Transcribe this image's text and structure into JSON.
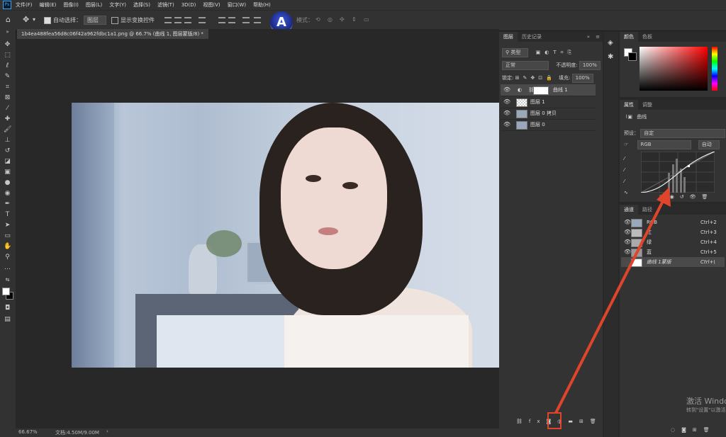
{
  "menubar": {
    "app_icon": "Ps",
    "items": [
      "文件(F)",
      "编辑(E)",
      "图像(I)",
      "图层(L)",
      "文字(Y)",
      "选择(S)",
      "滤镜(T)",
      "3D(D)",
      "视图(V)",
      "窗口(W)",
      "帮助(H)"
    ]
  },
  "options": {
    "auto_select_label": "自动选择：",
    "auto_select_value": "图层",
    "show_transform_label": "显示变换控件",
    "mode_3d_label": "模式："
  },
  "document": {
    "tab_title": "1b4ea488fea56d8c06f42a962fdbc1a1.png @ 66.7% (曲线 1, 图层蒙版/8) *"
  },
  "status": {
    "zoom": "66.67%",
    "doc_size": "文档:4.50M/9.00M"
  },
  "layers_panel": {
    "tabs": [
      "图层",
      "历史记录"
    ],
    "filter_label": "类型",
    "blend_mode": "正常",
    "opacity_label": "不透明度:",
    "opacity_value": "100%",
    "lock_label": "锁定:",
    "fill_label": "填充:",
    "fill_value": "100%",
    "layers": [
      {
        "name": "曲线 1",
        "selected": true
      },
      {
        "name": "图层 1",
        "selected": false
      },
      {
        "name": "图层 0 拷贝",
        "selected": false
      },
      {
        "name": "图层 0",
        "selected": false
      }
    ]
  },
  "color_panel": {
    "tabs": [
      "颜色",
      "色板"
    ]
  },
  "properties_panel": {
    "tabs": [
      "属性",
      "调整"
    ],
    "title": "曲线",
    "preset_label": "预设：",
    "preset_value": "自定",
    "channel_value": "RGB",
    "auto_label": "自动"
  },
  "channels_panel": {
    "tabs": [
      "通道",
      "路径"
    ],
    "channels": [
      {
        "name": "RGB",
        "shortcut": "Ctrl+2"
      },
      {
        "name": "红",
        "shortcut": "Ctrl+3"
      },
      {
        "name": "绿",
        "shortcut": "Ctrl+4"
      },
      {
        "name": "蓝",
        "shortcut": "Ctrl+5"
      },
      {
        "name": "曲线 1蒙版",
        "shortcut": "Ctrl+\\"
      }
    ]
  },
  "watermark": {
    "line1": "激活 Windows",
    "line2": "转到\"设置\"以激活"
  },
  "colors": {
    "annotation_red": "#e0452b",
    "panel_bg": "#333333",
    "selected_row": "#4a4a4a"
  }
}
